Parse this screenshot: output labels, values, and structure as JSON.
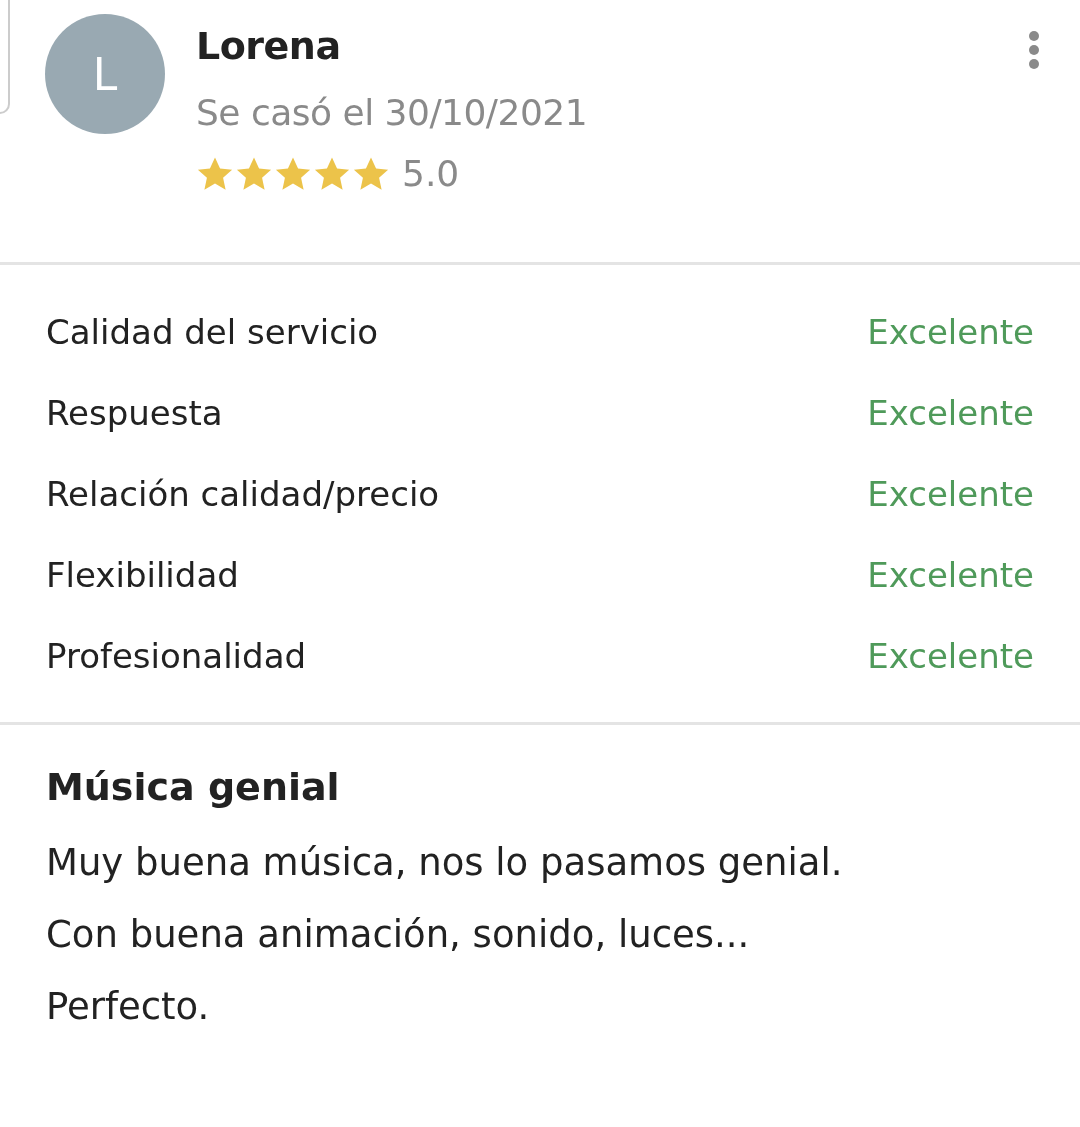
{
  "review": {
    "avatar_letter": "L",
    "name": "Lorena",
    "wedding_date": "Se casó el 30/10/2021",
    "stars": 5,
    "rating": "5.0"
  },
  "ratings": [
    {
      "label": "Calidad del servicio",
      "value": "Excelente"
    },
    {
      "label": "Respuesta",
      "value": "Excelente"
    },
    {
      "label": "Relación calidad/precio",
      "value": "Excelente"
    },
    {
      "label": "Flexibilidad",
      "value": "Excelente"
    },
    {
      "label": "Profesionalidad",
      "value": "Excelente"
    }
  ],
  "comment": {
    "title": "Música genial",
    "text": "Muy buena música, nos lo pasamos genial. Con buena animación, sonido, luces... Perfecto."
  }
}
